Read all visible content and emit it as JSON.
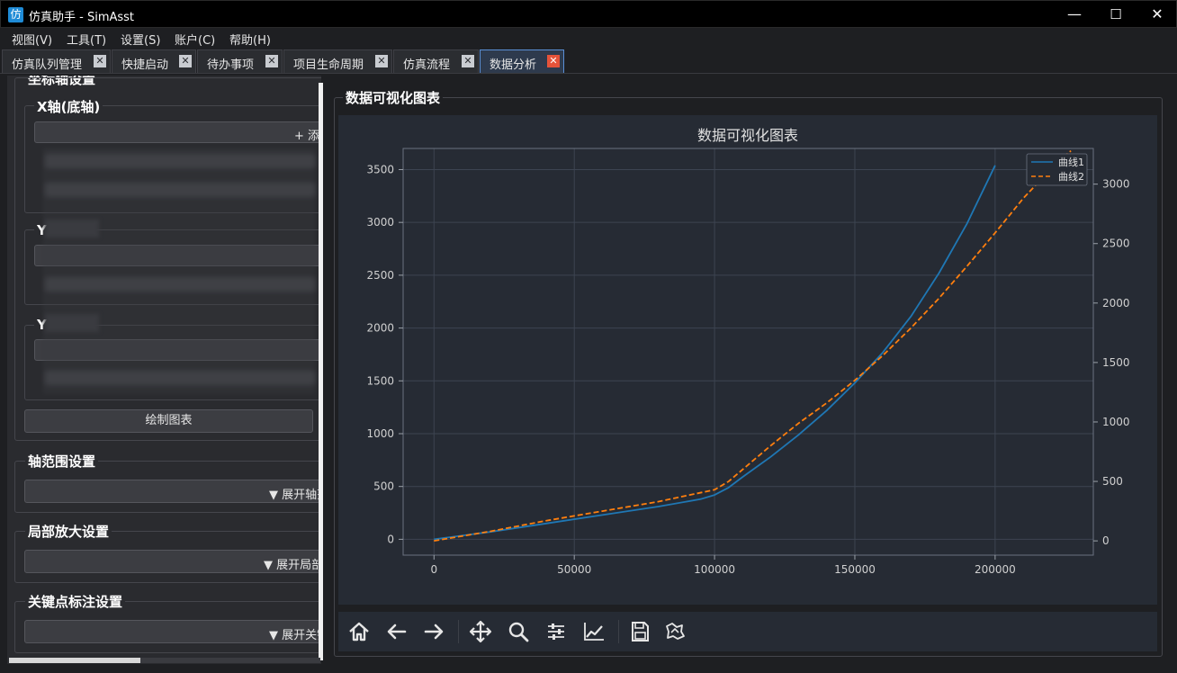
{
  "window": {
    "icon_glyph": "仿",
    "title": "仿真助手 - SimAsst",
    "minimize_glyph": "—",
    "maximize_glyph": "☐",
    "close_glyph": "✕"
  },
  "menu": [
    "视图(V)",
    "工具(T)",
    "设置(S)",
    "账户(C)",
    "帮助(H)"
  ],
  "tabs": [
    {
      "label": "仿真队列管理",
      "active": false
    },
    {
      "label": "快捷启动",
      "active": false
    },
    {
      "label": "待办事项",
      "active": false
    },
    {
      "label": "项目生命周期",
      "active": false
    },
    {
      "label": "仿真流程",
      "active": false
    },
    {
      "label": "数据分析",
      "active": true
    }
  ],
  "left_panel": {
    "top_cut_title": "坐标轴设置",
    "x_axis_group": {
      "title": "X轴(底轴)",
      "add_button": "+ 添加"
    },
    "y_left_title": "Y",
    "y_right_title": "Y",
    "draw_button": "绘制图表",
    "axis_range": {
      "title": "轴范围设置",
      "toggle": "▼ 展开轴范围设置"
    },
    "zoom": {
      "title": "局部放大设置",
      "toggle": "▼ 展开局部放大设置"
    },
    "keypoint": {
      "title": "关键点标注设置",
      "toggle": "▼ 展开关键点标注设置"
    }
  },
  "chart_group_title": "数据可视化图表",
  "chart_data": {
    "type": "line",
    "title": "数据可视化图表",
    "xlim": [
      -11000,
      235000
    ],
    "ylim_left": [
      -150,
      3700
    ],
    "ylim_right": [
      -120,
      3300
    ],
    "x_ticks": [
      0,
      50000,
      100000,
      150000,
      200000
    ],
    "y_ticks_left": [
      0,
      500,
      1000,
      1500,
      2000,
      2500,
      3000,
      3500
    ],
    "y_ticks_right": [
      0,
      500,
      1000,
      1500,
      2000,
      2500,
      3000
    ],
    "grid": true,
    "legend_position": "top-right",
    "series": [
      {
        "name": "曲线1",
        "axis": "left",
        "style": "solid",
        "color": "#1f77b4",
        "x": [
          0,
          20000,
          40000,
          60000,
          80000,
          95000,
          100000,
          105000,
          110000,
          120000,
          130000,
          140000,
          150000,
          160000,
          170000,
          180000,
          190000,
          200000
        ],
        "y": [
          0,
          70,
          150,
          230,
          310,
          380,
          420,
          490,
          590,
          780,
          990,
          1220,
          1480,
          1770,
          2110,
          2520,
          2990,
          3540
        ]
      },
      {
        "name": "曲线2",
        "axis": "right",
        "style": "dashed",
        "color": "#ff7f0e",
        "x": [
          0,
          20000,
          40000,
          60000,
          80000,
          100000,
          105000,
          110000,
          120000,
          130000,
          140000,
          150000,
          160000,
          170000,
          180000,
          190000,
          200000,
          210000,
          220000,
          227000
        ],
        "y": [
          0,
          80,
          170,
          250,
          330,
          430,
          500,
          600,
          800,
          990,
          1160,
          1350,
          1560,
          1790,
          2040,
          2310,
          2590,
          2880,
          3130,
          3280
        ]
      }
    ]
  },
  "toolbar": [
    {
      "name": "home-icon"
    },
    {
      "name": "back-arrow-icon"
    },
    {
      "name": "forward-arrow-icon"
    },
    {
      "name": "pan-icon"
    },
    {
      "name": "zoom-icon"
    },
    {
      "name": "subplots-config-icon"
    },
    {
      "name": "edit-axis-icon"
    },
    {
      "name": "save-icon"
    },
    {
      "name": "customize-icon"
    }
  ]
}
